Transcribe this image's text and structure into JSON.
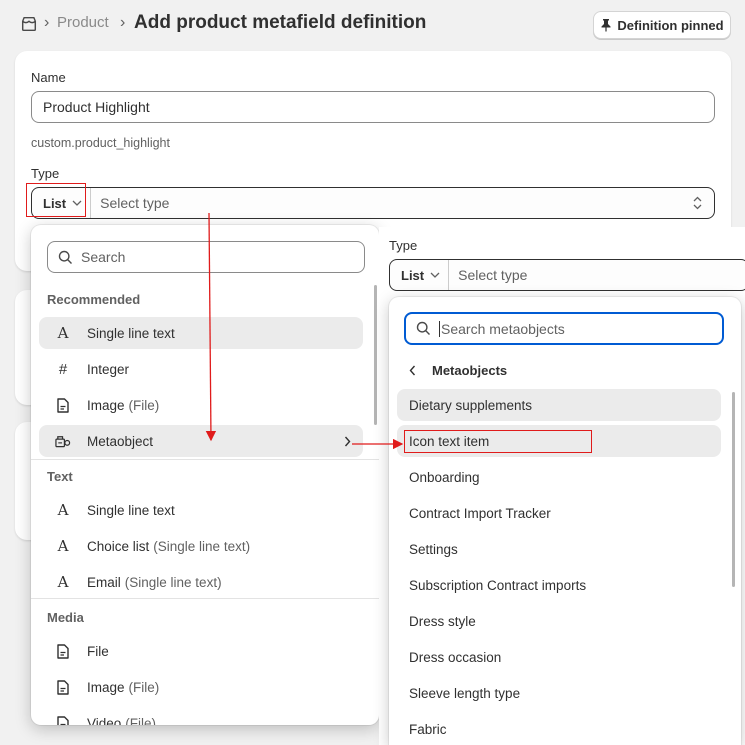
{
  "header": {
    "breadcrumb_parent": "Product",
    "title": "Add product metafield definition",
    "pin_button_label": "Definition pinned"
  },
  "form": {
    "name_label": "Name",
    "name_value": "Product Highlight",
    "namespace_key": "custom.product_highlight",
    "type_label": "Type",
    "list_label": "List",
    "select_placeholder": "Select type"
  },
  "type_dropdown": {
    "search_placeholder": "Search",
    "sections": [
      {
        "title": "Recommended",
        "items": [
          {
            "label": "Single line text",
            "suffix": "",
            "icon": "text-a-icon"
          },
          {
            "label": "Integer",
            "suffix": "",
            "icon": "hash-icon"
          },
          {
            "label": "Image",
            "suffix": "(File)",
            "icon": "file-icon"
          },
          {
            "label": "Metaobject",
            "suffix": "",
            "icon": "metaobject-icon"
          }
        ]
      },
      {
        "title": "Text",
        "items": [
          {
            "label": "Single line text",
            "suffix": "",
            "icon": "text-a-icon"
          },
          {
            "label": "Choice list",
            "suffix": "(Single line text)",
            "icon": "text-a-icon"
          },
          {
            "label": "Email",
            "suffix": "(Single line text)",
            "icon": "text-a-icon"
          }
        ]
      },
      {
        "title": "Media",
        "items": [
          {
            "label": "File",
            "suffix": "",
            "icon": "file-icon"
          },
          {
            "label": "Image",
            "suffix": "(File)",
            "icon": "file-icon"
          },
          {
            "label": "Video",
            "suffix": "(File)",
            "icon": "file-icon"
          }
        ]
      }
    ]
  },
  "right_panel": {
    "type_label": "Type",
    "list_label": "List",
    "select_placeholder": "Select type"
  },
  "metaobject_dropdown": {
    "search_placeholder": "Search metaobjects",
    "back_title": "Metaobjects",
    "items": [
      "Dietary supplements",
      "Icon text item",
      "Onboarding",
      "Contract Import Tracker",
      "Settings",
      "Subscription Contract imports",
      "Dress style",
      "Dress occasion",
      "Sleeve length type",
      "Fabric"
    ]
  },
  "colors": {
    "annotation_red": "#e01b1b",
    "focus_blue": "#005bd3"
  }
}
